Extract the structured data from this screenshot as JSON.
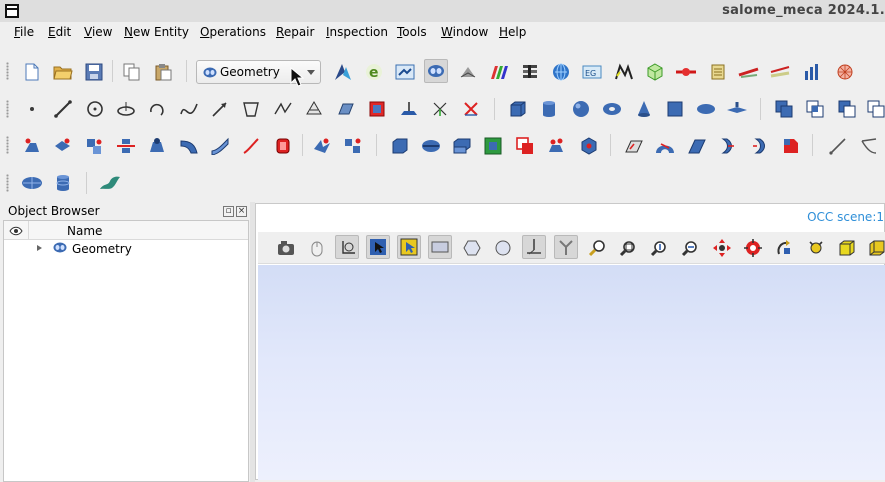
{
  "window": {
    "title": "salome_meca 2024.1."
  },
  "menu": [
    "File",
    "Edit",
    "View",
    "New Entity",
    "Operations",
    "Repair",
    "Inspection",
    "Tools",
    "Window",
    "Help"
  ],
  "toolbar": {
    "module_selector": {
      "value": "Geometry"
    },
    "std_icons": [
      "new-file-icon",
      "open-folder-icon",
      "save-icon",
      "copy-icon",
      "paste-icon"
    ],
    "module_icons": [
      "paravis-icon",
      "eficas-icon",
      "shaper-icon",
      "geometry-icon",
      "mesh-icon",
      "homard-icon",
      "smeca-icon",
      "jobmanager-icon",
      "yacs-icon",
      "medcalc-icon",
      "fields-icon",
      "asterstudy-icon",
      "pipe-icon",
      "scroll-icon",
      "measure-icon",
      "ruler-icon",
      "bars-icon",
      "lattice-icon"
    ],
    "basic_icons": [
      "point-icon",
      "line-icon",
      "circle-icon",
      "ellipse-icon",
      "arc-icon",
      "curve-icon",
      "vector-icon",
      "plane-icon",
      "lcs-icon",
      "sketch-icon",
      "face-icon",
      "rectangle-icon",
      "marker-icon",
      "axes-icon"
    ],
    "primitive_icons": [
      "box-icon",
      "cylinder-icon",
      "sphere-icon",
      "torus-icon",
      "cone-icon",
      "square-face-icon",
      "disk-icon",
      "annulus-icon",
      "fuse-icon",
      "common-icon",
      "cut-icon",
      "section-icon"
    ],
    "ops_icons": [
      "extrude-icon",
      "revolve-icon",
      "translate-icon",
      "mirror-icon",
      "filling-icon",
      "pipe-sweep-icon",
      "thicken-icon",
      "edge-icon",
      "wire-icon",
      "scale-icon",
      "offset-icon",
      "shell-icon",
      "solid-icon",
      "compound-icon",
      "partition-icon",
      "glue-icon",
      "shape-process-icon",
      "sewing-icon",
      "arch-icon",
      "fillet-icon",
      "chamfer-icon",
      "fillet2d-icon",
      "fillet1d-icon",
      "check-icon",
      "dim-icon"
    ],
    "extra_icons": [
      "hemisphere-icon",
      "database-icon",
      "surface-icon"
    ]
  },
  "object_browser": {
    "title": "Object Browser",
    "column_header": "Name",
    "items": [
      {
        "label": "Geometry"
      }
    ]
  },
  "viewer": {
    "tab_label": "OCC scene:1",
    "toolbar_icons": [
      "dump-view-icon",
      "mouse-icon",
      "trihedron-icon",
      "select-icon",
      "select-highlight-icon",
      "rect-select-icon",
      "polygon-select-icon",
      "circle-select-icon",
      "axis-icon",
      "fork-icon",
      "zoom-fit-icon",
      "zoom-area-icon",
      "zoom-icon",
      "zoom-in-icon",
      "pan-icon",
      "global-pan-icon",
      "rotate-icon",
      "rotate-center-icon",
      "front-view-icon",
      "back-view-icon"
    ],
    "background": {
      "top": "#d3ddf6",
      "bottom": "#edf0fd"
    }
  }
}
